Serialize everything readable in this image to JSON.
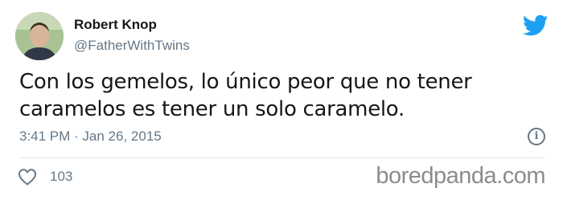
{
  "tweet": {
    "author": {
      "display_name": "Robert Knop",
      "handle": "@FatherWithTwins"
    },
    "text_line_1": "Con los gemelos, lo único peor que no tener",
    "text_line_2": "caramelos es tener un solo caramelo.",
    "timestamp": "3:41 PM · Jan 26, 2015",
    "likes": "103"
  },
  "icons": {
    "brand": "twitter-bird-icon",
    "info": "info-icon",
    "like": "heart-icon"
  },
  "colors": {
    "twitter_blue": "#1da1f2",
    "secondary_text": "#657786",
    "primary_text": "#14171a",
    "divider": "#e1e8ed"
  },
  "watermark": "boredpanda.com"
}
